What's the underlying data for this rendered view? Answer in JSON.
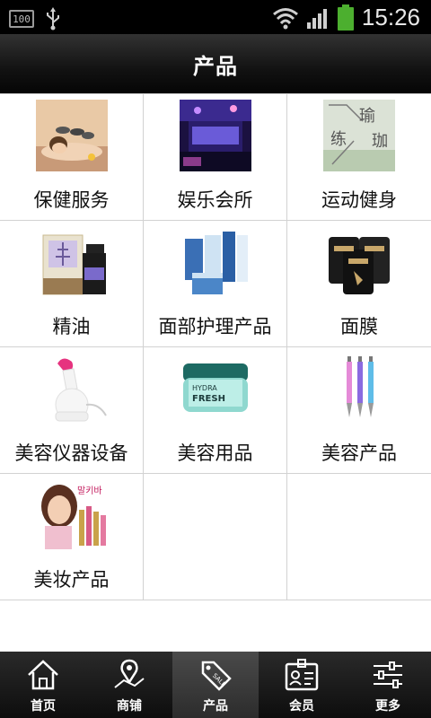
{
  "status_bar": {
    "left_icons": [
      "battery-100-icon",
      "usb-icon"
    ],
    "battery_text": "100",
    "right_icons": [
      "wifi-icon",
      "signal-icon",
      "battery-icon"
    ],
    "time": "15:26"
  },
  "header": {
    "title": "产品"
  },
  "products": [
    {
      "label": "保健服务",
      "icon": "spa-massage-photo"
    },
    {
      "label": "娱乐会所",
      "icon": "club-interior-photo"
    },
    {
      "label": "运动健身",
      "icon": "yoga-photo"
    },
    {
      "label": "精油",
      "icon": "essential-oil-photo"
    },
    {
      "label": "面部护理产品",
      "icon": "facial-care-photo"
    },
    {
      "label": "面膜",
      "icon": "face-mask-photo"
    },
    {
      "label": "美容仪器设备",
      "icon": "facial-steamer-photo"
    },
    {
      "label": "美容用品",
      "icon": "cream-jar-photo"
    },
    {
      "label": "美容产品",
      "icon": "beauty-pens-photo"
    },
    {
      "label": "美妆产品",
      "icon": "makeup-model-photo"
    }
  ],
  "yoga_thumb_text": {
    "top": "瑜",
    "mid_left": "练",
    "mid_right": "珈"
  },
  "cream_thumb_text": {
    "line1": "HYDRA",
    "line2": "FRESH"
  },
  "makeup_thumb_text": "말키바",
  "tabbar": {
    "active_index": 2,
    "tabs": [
      {
        "label": "首页",
        "icon": "home-icon"
      },
      {
        "label": "商铺",
        "icon": "map-pin-icon"
      },
      {
        "label": "产品",
        "icon": "sale-tag-icon"
      },
      {
        "label": "会员",
        "icon": "member-card-icon"
      },
      {
        "label": "更多",
        "icon": "sliders-icon"
      }
    ]
  },
  "colors": {
    "header_bg": "#121212",
    "grid_line": "#d2d2d2",
    "battery_green": "#4caf2f",
    "tab_active_bg": "#3a3a3a"
  }
}
